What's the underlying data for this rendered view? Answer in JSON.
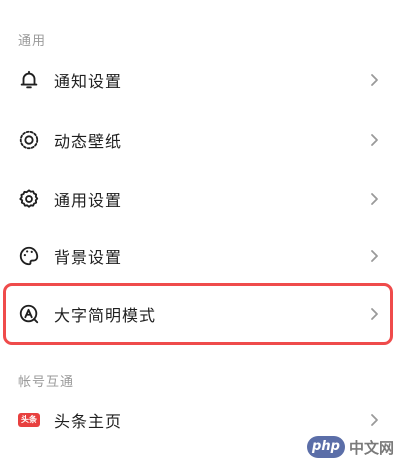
{
  "sections": {
    "general": {
      "label": "通用"
    },
    "account": {
      "label": "帐号互通"
    }
  },
  "items": {
    "notification": {
      "label": "通知设置",
      "icon": "bell-icon"
    },
    "wallpaper": {
      "label": "动态壁纸",
      "icon": "dynamic-wallpaper-icon"
    },
    "general": {
      "label": "通用设置",
      "icon": "gear-icon"
    },
    "background": {
      "label": "背景设置",
      "icon": "palette-icon"
    },
    "large_font": {
      "label": "大字简明模式",
      "icon": "large-font-icon"
    },
    "toutiao": {
      "label": "头条主页",
      "icon": "toutiao-badge-icon",
      "badge_text": "头条"
    }
  },
  "watermark": {
    "logo": "php",
    "text": "中文网"
  },
  "colors": {
    "highlight": "#ef4b4b",
    "badge": "#e8403f",
    "section_label": "#9a9a9a",
    "label": "#1f1f1f",
    "chevron": "#9a9a9a"
  }
}
